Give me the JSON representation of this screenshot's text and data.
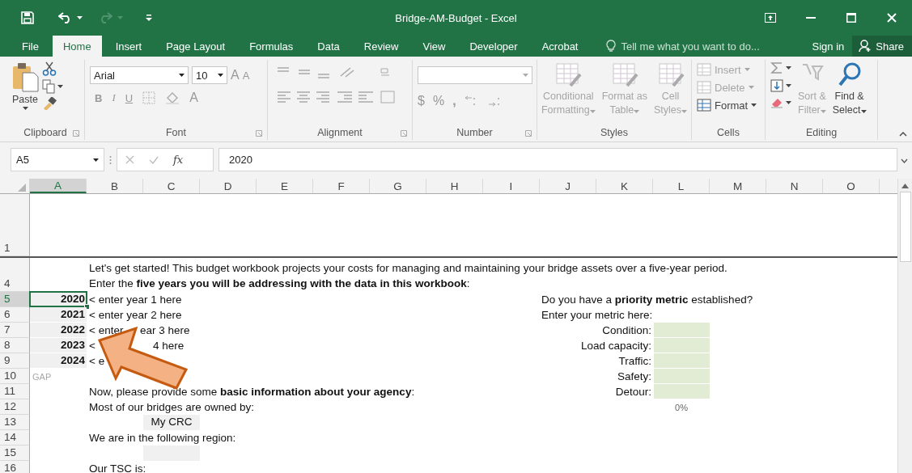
{
  "title_bar": {
    "title": "Bridge-AM-Budget - Excel"
  },
  "tabs": [
    {
      "label": "File",
      "selected": false
    },
    {
      "label": "Home",
      "selected": true
    },
    {
      "label": "Insert",
      "selected": false
    },
    {
      "label": "Page Layout",
      "selected": false
    },
    {
      "label": "Formulas",
      "selected": false
    },
    {
      "label": "Data",
      "selected": false
    },
    {
      "label": "Review",
      "selected": false
    },
    {
      "label": "View",
      "selected": false
    },
    {
      "label": "Developer",
      "selected": false
    },
    {
      "label": "Acrobat",
      "selected": false
    }
  ],
  "tell_me": {
    "placeholder": "Tell me what you want to do..."
  },
  "account": {
    "sign_in": "Sign in",
    "share": "Share"
  },
  "ribbon": {
    "clipboard": {
      "label": "Clipboard",
      "paste": "Paste"
    },
    "font": {
      "label": "Font",
      "family": "Arial",
      "size": "10",
      "grow": "A",
      "shrink": "A",
      "bold": "B",
      "italic": "I",
      "underline": "U",
      "font_color_letter": "A"
    },
    "alignment": {
      "label": "Alignment"
    },
    "number": {
      "label": "Number",
      "currency": "$",
      "percent": "%",
      "comma": ","
    },
    "styles": {
      "label": "Styles",
      "buttons": [
        {
          "lines": [
            "Conditional",
            "Formatting"
          ],
          "disabled": true
        },
        {
          "lines": [
            "Format as",
            "Table"
          ],
          "disabled": true
        },
        {
          "lines": [
            "Cell",
            "Styles"
          ],
          "disabled": true
        }
      ]
    },
    "cells": {
      "label": "Cells",
      "buttons": [
        {
          "label": "Insert",
          "disabled": true
        },
        {
          "label": "Delete",
          "disabled": true
        },
        {
          "label": "Format",
          "disabled": false
        }
      ]
    },
    "editing": {
      "label": "Editing",
      "buttons": [
        {
          "lines": [
            "Sort &",
            "Filter"
          ],
          "disabled": true
        },
        {
          "lines": [
            "Find &",
            "Select"
          ],
          "disabled": false
        }
      ]
    }
  },
  "formula_bar": {
    "name_box": "A5",
    "fx": "fx",
    "value": "2020"
  },
  "sheet": {
    "columns": [
      {
        "label": "A",
        "selected": true
      },
      {
        "label": "B",
        "selected": false
      },
      {
        "label": "C",
        "selected": false
      },
      {
        "label": "D",
        "selected": false
      },
      {
        "label": "E",
        "selected": false
      },
      {
        "label": "F",
        "selected": false
      },
      {
        "label": "G",
        "selected": false
      },
      {
        "label": "H",
        "selected": false
      },
      {
        "label": "I",
        "selected": false
      },
      {
        "label": "J",
        "selected": false
      },
      {
        "label": "K",
        "selected": false
      },
      {
        "label": "L",
        "selected": false
      },
      {
        "label": "M",
        "selected": false
      },
      {
        "label": "N",
        "selected": false
      },
      {
        "label": "O",
        "selected": false
      }
    ],
    "rows": [
      {
        "number": "1",
        "kind": "tall",
        "selected": false
      },
      {
        "number": "4",
        "kind": "double",
        "selected": false,
        "cells": [
          {
            "kind": "paragraph",
            "lines": [
              "Let's get started! This budget workbook projects your costs for managing and maintaining your bridge assets over a five-year period.",
              "Enter the **five years you will be addressing with the data in this workbook**:"
            ]
          }
        ]
      },
      {
        "number": "5",
        "kind": "normal",
        "selected": true,
        "cells": [
          {
            "kind": "year",
            "text": "2020",
            "selected": true
          },
          {
            "kind": "text",
            "text": "< enter year 1 here"
          },
          {
            "kind": "question",
            "text": "Do you have a **priority metric** established?"
          }
        ]
      },
      {
        "number": "6",
        "kind": "normal",
        "selected": false,
        "cells": [
          {
            "kind": "year",
            "text": "2021",
            "selected": false
          },
          {
            "kind": "text",
            "text": "< enter year 2 here"
          },
          {
            "kind": "question",
            "text": "Enter your metric here:"
          }
        ]
      },
      {
        "number": "7",
        "kind": "normal",
        "selected": false,
        "cells": [
          {
            "kind": "year",
            "text": "2022",
            "selected": false
          },
          {
            "kind": "text",
            "text": "< enter"
          },
          {
            "kind": "fragment_a",
            "text": "ear 3 here"
          },
          {
            "kind": "metric_label",
            "text": "Condition:"
          },
          {
            "kind": "metric_input"
          }
        ]
      },
      {
        "number": "8",
        "kind": "normal",
        "selected": false,
        "cells": [
          {
            "kind": "year",
            "text": "2023",
            "selected": false
          },
          {
            "kind": "text",
            "text": "<"
          },
          {
            "kind": "fragment_b",
            "text": "4 here"
          },
          {
            "kind": "metric_label",
            "text": "Load capacity:"
          },
          {
            "kind": "metric_input"
          }
        ]
      },
      {
        "number": "9",
        "kind": "normal",
        "selected": false,
        "cells": [
          {
            "kind": "year",
            "text": "2024",
            "selected": false
          },
          {
            "kind": "text",
            "text": "< e"
          },
          {
            "kind": "metric_label",
            "text": "Traffic:"
          },
          {
            "kind": "metric_input"
          }
        ]
      },
      {
        "number": "10",
        "kind": "normal",
        "selected": false,
        "cells": [
          {
            "kind": "faint",
            "text": "GAP"
          },
          {
            "kind": "metric_label",
            "text": "Safety:"
          },
          {
            "kind": "metric_input"
          }
        ]
      },
      {
        "number": "11",
        "kind": "normal",
        "selected": false,
        "cells": [
          {
            "kind": "text",
            "text": "Now, please provide some **basic information about your agency**:"
          },
          {
            "kind": "metric_label",
            "text": "Detour:"
          },
          {
            "kind": "metric_input"
          }
        ]
      },
      {
        "number": "12",
        "kind": "normal",
        "selected": false,
        "cells": [
          {
            "kind": "text",
            "text": "Most of our bridges are owned by:"
          },
          {
            "kind": "percent",
            "text": "0%"
          }
        ]
      },
      {
        "number": "13",
        "kind": "normal",
        "selected": false,
        "cells": [
          {
            "kind": "choice",
            "text": "My CRC"
          }
        ]
      },
      {
        "number": "14",
        "kind": "normal",
        "selected": false,
        "cells": [
          {
            "kind": "text",
            "text": "We are in the following region:"
          }
        ]
      },
      {
        "number": "15",
        "kind": "normal",
        "selected": false,
        "cells": [
          {
            "kind": "choice"
          }
        ]
      },
      {
        "number": "16",
        "kind": "normal",
        "selected": false,
        "cells": [
          {
            "kind": "text",
            "text": "Our TSC is:"
          }
        ]
      }
    ]
  }
}
